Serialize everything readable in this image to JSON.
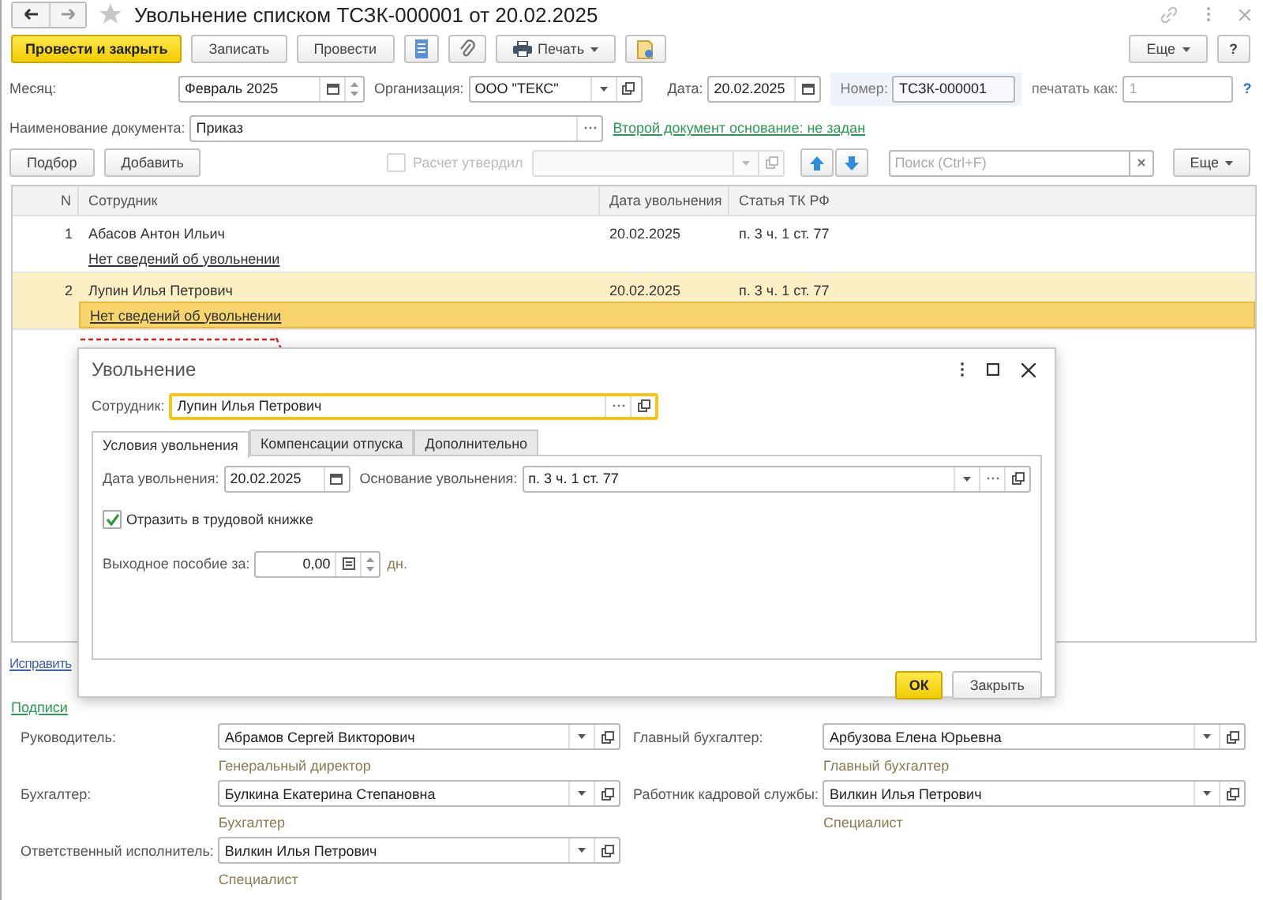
{
  "window": {
    "title": "Увольнение списком ТСЗК-000001 от 20.02.2025"
  },
  "toolbar": {
    "primary": "Провести и закрыть",
    "buttons": [
      "Записать",
      "Провести"
    ],
    "print": "Печать",
    "more": "Еще",
    "help": "?"
  },
  "header": {
    "month_label": "Месяц:",
    "month": "Февраль 2025",
    "org_label": "Организация:",
    "org": "ООО \"ТЕКС\"",
    "date_label": "Дата:",
    "date": "20.02.2025",
    "number_label": "Номер:",
    "number": "ТСЗК-000001",
    "print_as_label": "печатать как:",
    "print_as_placeholder": "1",
    "help": "?",
    "doc_name_label": "Наименование документа:",
    "doc_name": "Приказ",
    "basis_link": "Второй документ основание: не задан"
  },
  "table_toolbar": {
    "buttons": [
      "Подбор",
      "Добавить"
    ],
    "approved": {
      "label": "Расчет утвердил",
      "checked": false,
      "disabled": true
    },
    "search_placeholder": "Поиск (Ctrl+F)",
    "more": "Еще"
  },
  "table": {
    "columns": [
      "N",
      "Сотрудник",
      "Дата увольнения",
      "Статья ТК РФ"
    ],
    "rows": [
      {
        "n": "1",
        "employee": "Абасов Антон Ильич",
        "date": "20.02.2025",
        "article": "п. 3 ч. 1 ст. 77",
        "link": "Нет сведений об увольнении",
        "selected": false
      },
      {
        "n": "2",
        "employee": "Лупин Илья Петрович",
        "date": "20.02.2025",
        "article": "п. 3 ч. 1 ст. 77",
        "link": "Нет сведений об увольнении",
        "selected": true
      }
    ]
  },
  "fix_link": "Исправить",
  "signatures": {
    "title": "Подписи",
    "left": [
      {
        "label": "Руководитель:",
        "value": "Абрамов Сергей Викторович",
        "position": "Генеральный директор"
      },
      {
        "label": "Бухгалтер:",
        "value": "Булкина Екатерина Степановна",
        "position": "Бухгалтер"
      },
      {
        "label": "Ответственный исполнитель:",
        "value": "Вилкин Илья Петрович",
        "position": "Специалист"
      }
    ],
    "right": [
      {
        "label": "Главный бухгалтер:",
        "value": "Арбузова Елена Юрьевна",
        "position": "Главный бухгалтер"
      },
      {
        "label": "Работник кадровой службы:",
        "value": "Вилкин Илья Петрович",
        "position": "Специалист"
      }
    ]
  },
  "dialog": {
    "title": "Увольнение",
    "employee_label": "Сотрудник:",
    "employee": "Лупин Илья Петрович",
    "tabs": [
      {
        "label": "Условия увольнения",
        "selected": true
      },
      {
        "label": "Компенсации отпуска",
        "selected": false
      },
      {
        "label": "Дополнительно",
        "selected": false
      }
    ],
    "date_label": "Дата увольнения:",
    "date": "20.02.2025",
    "basis_label": "Основание увольнения:",
    "basis": "п. 3 ч. 1 ст. 77",
    "work_book": {
      "label": "Отразить в трудовой книжке",
      "checked": true
    },
    "severance_label": "Выходное пособие за:",
    "severance": "0,00",
    "severance_unit": "дн.",
    "ok": "ОК",
    "close": "Закрыть"
  }
}
